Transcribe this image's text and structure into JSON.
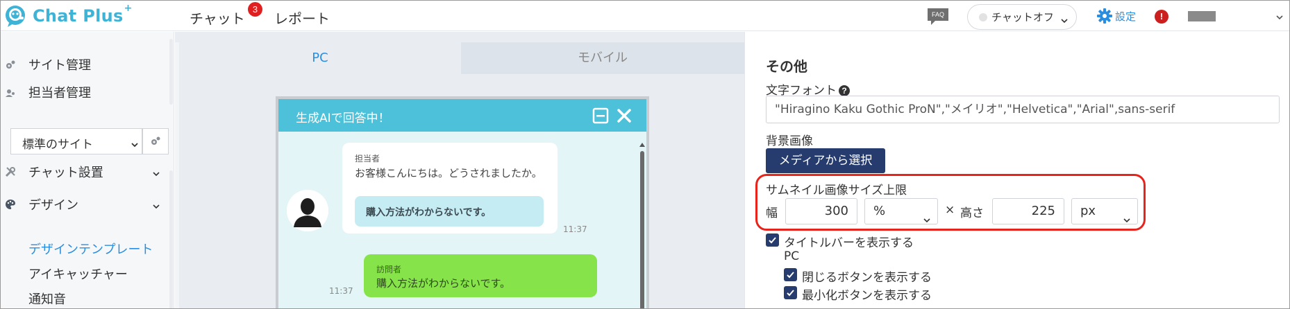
{
  "header": {
    "logo_text": "Chat Plus",
    "logo_plus": "+",
    "nav": {
      "chat": "チャット",
      "chat_badge": "3",
      "report": "レポート"
    },
    "faq": "FAQ",
    "chat_toggle": "チャットオフ",
    "settings": "設定",
    "alert": "!"
  },
  "sidebar": {
    "site_manage": "サイト管理",
    "staff_manage": "担当者管理",
    "site_select": "標準のサイト",
    "chat_setup": "チャット設置",
    "design": "デザイン",
    "design_template": "デザインテンプレート",
    "eyecatcher": "アイキャッチャー",
    "notify_sound": "通知音"
  },
  "preview": {
    "tabs": [
      {
        "label": "PC"
      },
      {
        "label": "モバイル"
      }
    ],
    "widget_title": "生成AIで回答中！",
    "agent_name": "担当者",
    "agent_message": "お客様こんにちは。どうされましたか。",
    "quick_reply": "購入方法がわからないです。",
    "agent_time": "11:37",
    "visitor_name": "訪問者",
    "visitor_message": "購入方法がわからないです。",
    "visitor_time": "11:37"
  },
  "panel": {
    "title": "その他",
    "font_label": "文字フォント",
    "help": "?",
    "font_value": "\"Hiragino Kaku Gothic ProN\",\"メイリオ\",\"Helvetica\",\"Arial\",sans-serif",
    "bg_image_label": "背景画像",
    "media_button": "メディアから選択",
    "thumb_label": "サムネイル画像サイズ上限",
    "width_label": "幅",
    "width_value": "300",
    "width_unit": "%",
    "times": "×",
    "height_label": "高さ",
    "height_value": "225",
    "height_unit": "px",
    "show_titlebar": "タイトルバーを表示する",
    "pc_label": "PC",
    "show_close": "閉じるボタンを表示する",
    "show_minimize": "最小化ボタンを表示する"
  },
  "colors": {
    "brand": "#3fb3d6",
    "accent_blue": "#2a8ee0",
    "widget_title": "#4dc1d9",
    "primary_button": "#263b6e",
    "highlight_border": "#e8231c",
    "visitor_bubble": "#86e34a"
  }
}
